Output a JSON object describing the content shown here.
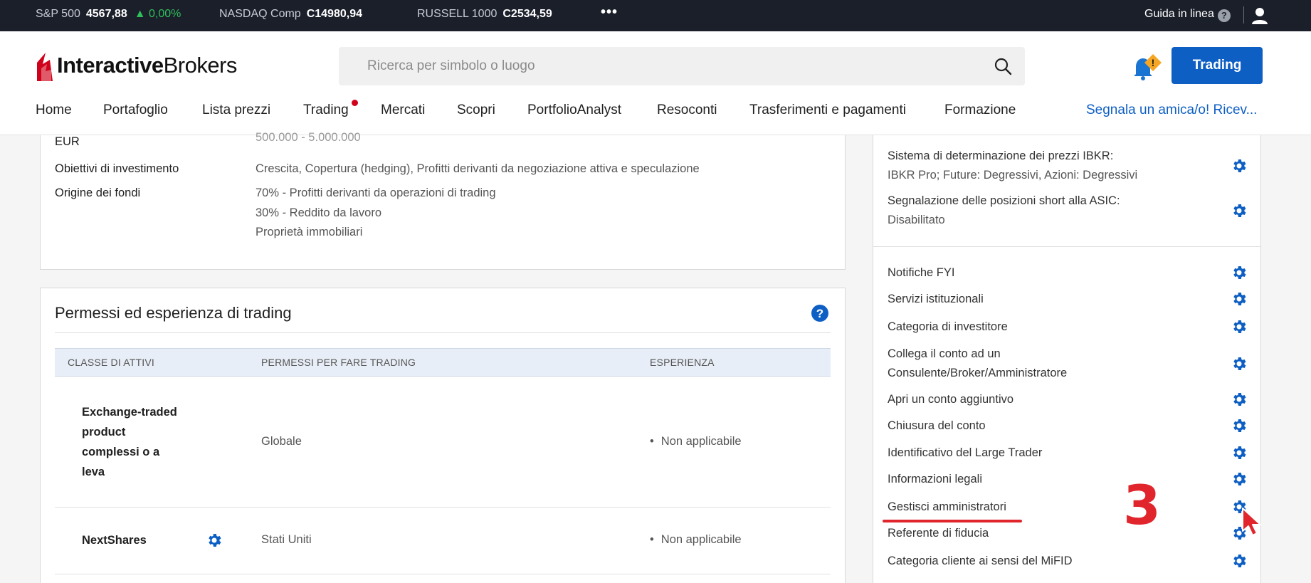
{
  "ticker": {
    "items": [
      {
        "name": "S&P 500",
        "value": "4567,88",
        "change": "▲ 0,00%"
      },
      {
        "name": "NASDAQ Comp",
        "value": "C14980,94"
      },
      {
        "name": "RUSSELL 1000",
        "value": "C2534,59"
      }
    ],
    "more": "•••",
    "help_label": "Guida in linea",
    "help_icon": "?"
  },
  "header": {
    "logo_bold": "Interactive",
    "logo_regular": "Brokers",
    "search_placeholder": "Ricerca per simbolo o luogo",
    "trading_button": "Trading",
    "bell_badge": "!"
  },
  "nav": {
    "items": [
      "Home",
      "Portafoglio",
      "Lista prezzi",
      "Trading",
      "Mercati",
      "Scopri",
      "PortfolioAnalyst",
      "Resoconti",
      "Trasferimenti e pagamenti",
      "Formazione"
    ],
    "refer": "Segnala un amica/o! Ricev..."
  },
  "profile": {
    "cut_value": "500.000 - 5.000.000",
    "eur_label": "EUR",
    "objectives_label": "Obiettivi di investimento",
    "objectives_value": "Crescita, Copertura (hedging), Profitti derivanti da negoziazione attiva e speculazione",
    "funds_label": "Origine dei fondi",
    "funds_values": [
      "70% - Profitti derivanti da operazioni di trading",
      "30% - Reddito da lavoro",
      "Proprietà immobiliari"
    ]
  },
  "permissions": {
    "title": "Permessi ed esperienza di trading",
    "help_icon": "?",
    "columns": [
      "CLASSE DI ATTIVI",
      "PERMESSI PER FARE TRADING",
      "ESPERIENZA"
    ],
    "rows": [
      {
        "asset_lines": [
          "Exchange-traded",
          "product",
          "complessi o a",
          "leva"
        ],
        "permission": "Globale",
        "experience": "Non applicabile"
      },
      {
        "asset_lines": [
          "NextShares"
        ],
        "permission": "Stati Uniti",
        "experience": "Non applicabile"
      }
    ]
  },
  "settings": {
    "top": [
      {
        "label": "Sistema di determinazione dei prezzi IBKR:",
        "value": "IBKR Pro; Future: Degressivi, Azioni: Degressivi"
      },
      {
        "label": "Segnalazione delle posizioni short alla ASIC:",
        "value": "Disabilitato"
      }
    ],
    "items": [
      {
        "label": "Notifiche FYI"
      },
      {
        "label": "Servizi istituzionali"
      },
      {
        "label": "Categoria di investitore"
      },
      {
        "label": "Collega il conto ad un",
        "label2": "Consulente/Broker/Amministratore"
      },
      {
        "label": "Apri un conto aggiuntivo"
      },
      {
        "label": "Chiusura del conto"
      },
      {
        "label": "Identificativo del Large Trader"
      },
      {
        "label": "Informazioni legali"
      },
      {
        "label": "Gestisci amministratori"
      },
      {
        "label": "Referente di fiducia"
      },
      {
        "label": "Categoria cliente ai sensi del MiFID"
      }
    ]
  },
  "annotation": {
    "step_number": "3",
    "color": "#e0262c"
  },
  "colors": {
    "accent": "#0e5fc4",
    "ticker_bg": "#1b1f2a",
    "positive": "#2fbf5b"
  }
}
